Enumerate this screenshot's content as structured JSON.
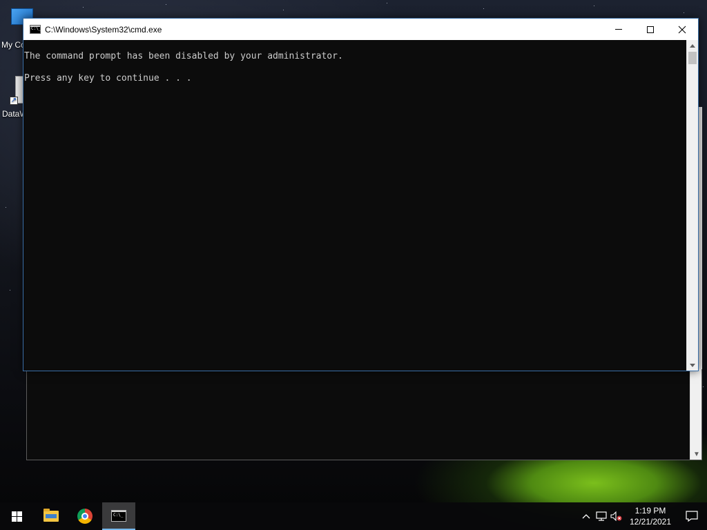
{
  "desktop": {
    "icons": [
      {
        "label": "My Co"
      },
      {
        "label": "DataW"
      }
    ]
  },
  "cmd_window": {
    "title": "C:\\Windows\\System32\\cmd.exe",
    "console_lines": [
      "The command prompt has been disabled by your administrator.",
      "Press any key to continue . . ."
    ]
  },
  "taskbar": {
    "pinned": [
      {
        "name": "start",
        "icon": "windows-logo-icon"
      },
      {
        "name": "file-explorer",
        "icon": "folder-icon"
      },
      {
        "name": "chrome",
        "icon": "chrome-icon"
      },
      {
        "name": "command-prompt",
        "icon": "cmd-icon",
        "active": true
      }
    ],
    "clock": {
      "time": "1:19 PM",
      "date": "12/21/2021"
    }
  },
  "colors": {
    "console_bg": "#0c0c0c",
    "console_text": "#cccccc",
    "taskbar_active_underline": "#76b9ed"
  }
}
